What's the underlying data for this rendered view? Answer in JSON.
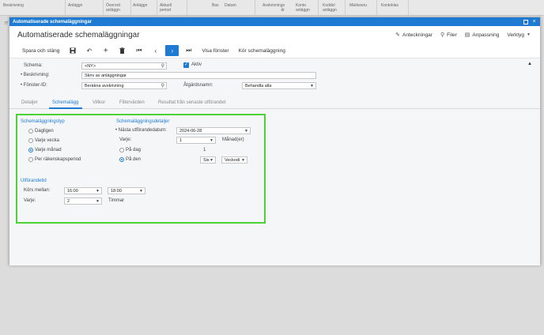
{
  "background": {
    "columns": [
      "Beskrivning",
      "Anläggn",
      "Överord\nanläggn",
      "Anläggn",
      "Aktuell\nperiod",
      "Bas",
      "Datum",
      "Avskrivnings\når",
      "Konto\nanläggn",
      "Koddel\nanläggn",
      "Märkesnu",
      "Kontoklas"
    ],
    "row_marker": "IT"
  },
  "window": {
    "title": "Automatiserade schemaläggningar",
    "minimize": "−",
    "close": "×"
  },
  "header": {
    "title": "Automatiserade schemaläggningar",
    "notes": "Anteckningar",
    "files": "Filer",
    "customize": "Anpassning",
    "tools": "Verktyg"
  },
  "toolbar": {
    "save_close": "Spara och stäng",
    "show_window": "Visa fönster",
    "run_schedule": "Kör schemaläggning"
  },
  "form": {
    "schema_label": "Schema:",
    "schema_value": "<NY>",
    "active_label": "Aktiv",
    "description_label": "Beskrivning:",
    "description_value": "Skriv av anläggningar",
    "window_id_label": "Fönster-ID:",
    "window_id_value": "Beräkna avskrivning",
    "action_label": "Åtgärdsnamn:",
    "action_value": "Behandla alla"
  },
  "tabs": [
    "Detaljer",
    "Schemalägg",
    "Villkor",
    "Filtervärden",
    "Resultat från senaste utförandet"
  ],
  "schedule": {
    "type_title": "Schemaläggningstyp",
    "daily": "Dagligen",
    "weekly": "Varje vecka",
    "monthly": "Varje månad",
    "per_period": "Per räkenskapsperiod",
    "details_title": "Schemaläggningsdetaljer",
    "next_date_label": "Nästa utförandedatum:",
    "next_date_value": "2024-06-28",
    "every_label": "Varje:",
    "every_value": "1",
    "every_unit": "Månad(er)",
    "on_day_label": "På dag",
    "on_day_value": "1",
    "on_the_label": "På den",
    "on_the_ordinal": "Sis",
    "on_the_weekday": "Veckodi",
    "exec_title": "Utförandetid",
    "runs_between_label": "Körs mellan:",
    "runs_from": "16:00",
    "runs_to": "18:00",
    "every2_label": "Varje:",
    "every2_value": "2",
    "every2_unit": "Timmar"
  }
}
